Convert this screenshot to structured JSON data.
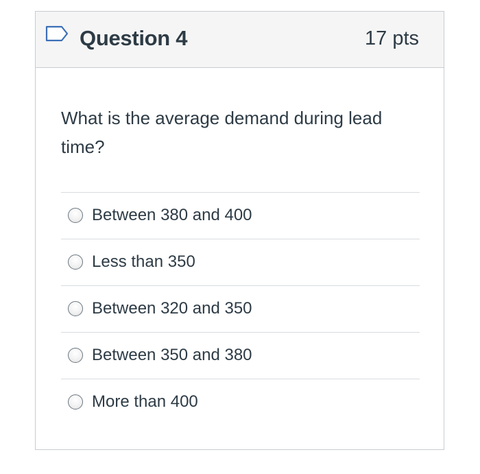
{
  "question": {
    "title": "Question 4",
    "points": "17 pts",
    "text": "What is the average demand during lead time?",
    "flag_icon": "flag-outline-icon"
  },
  "answers": [
    {
      "label": "Between 380 and 400",
      "selected": false
    },
    {
      "label": "Less than 350",
      "selected": false
    },
    {
      "label": "Between 320 and 350",
      "selected": false
    },
    {
      "label": "Between 350 and 380",
      "selected": false
    },
    {
      "label": "More than 400",
      "selected": false
    }
  ],
  "colors": {
    "text": "#2d3b45",
    "header_bg": "#f5f5f5",
    "border": "#c7cdd1",
    "flag": "#3b6fb6"
  }
}
